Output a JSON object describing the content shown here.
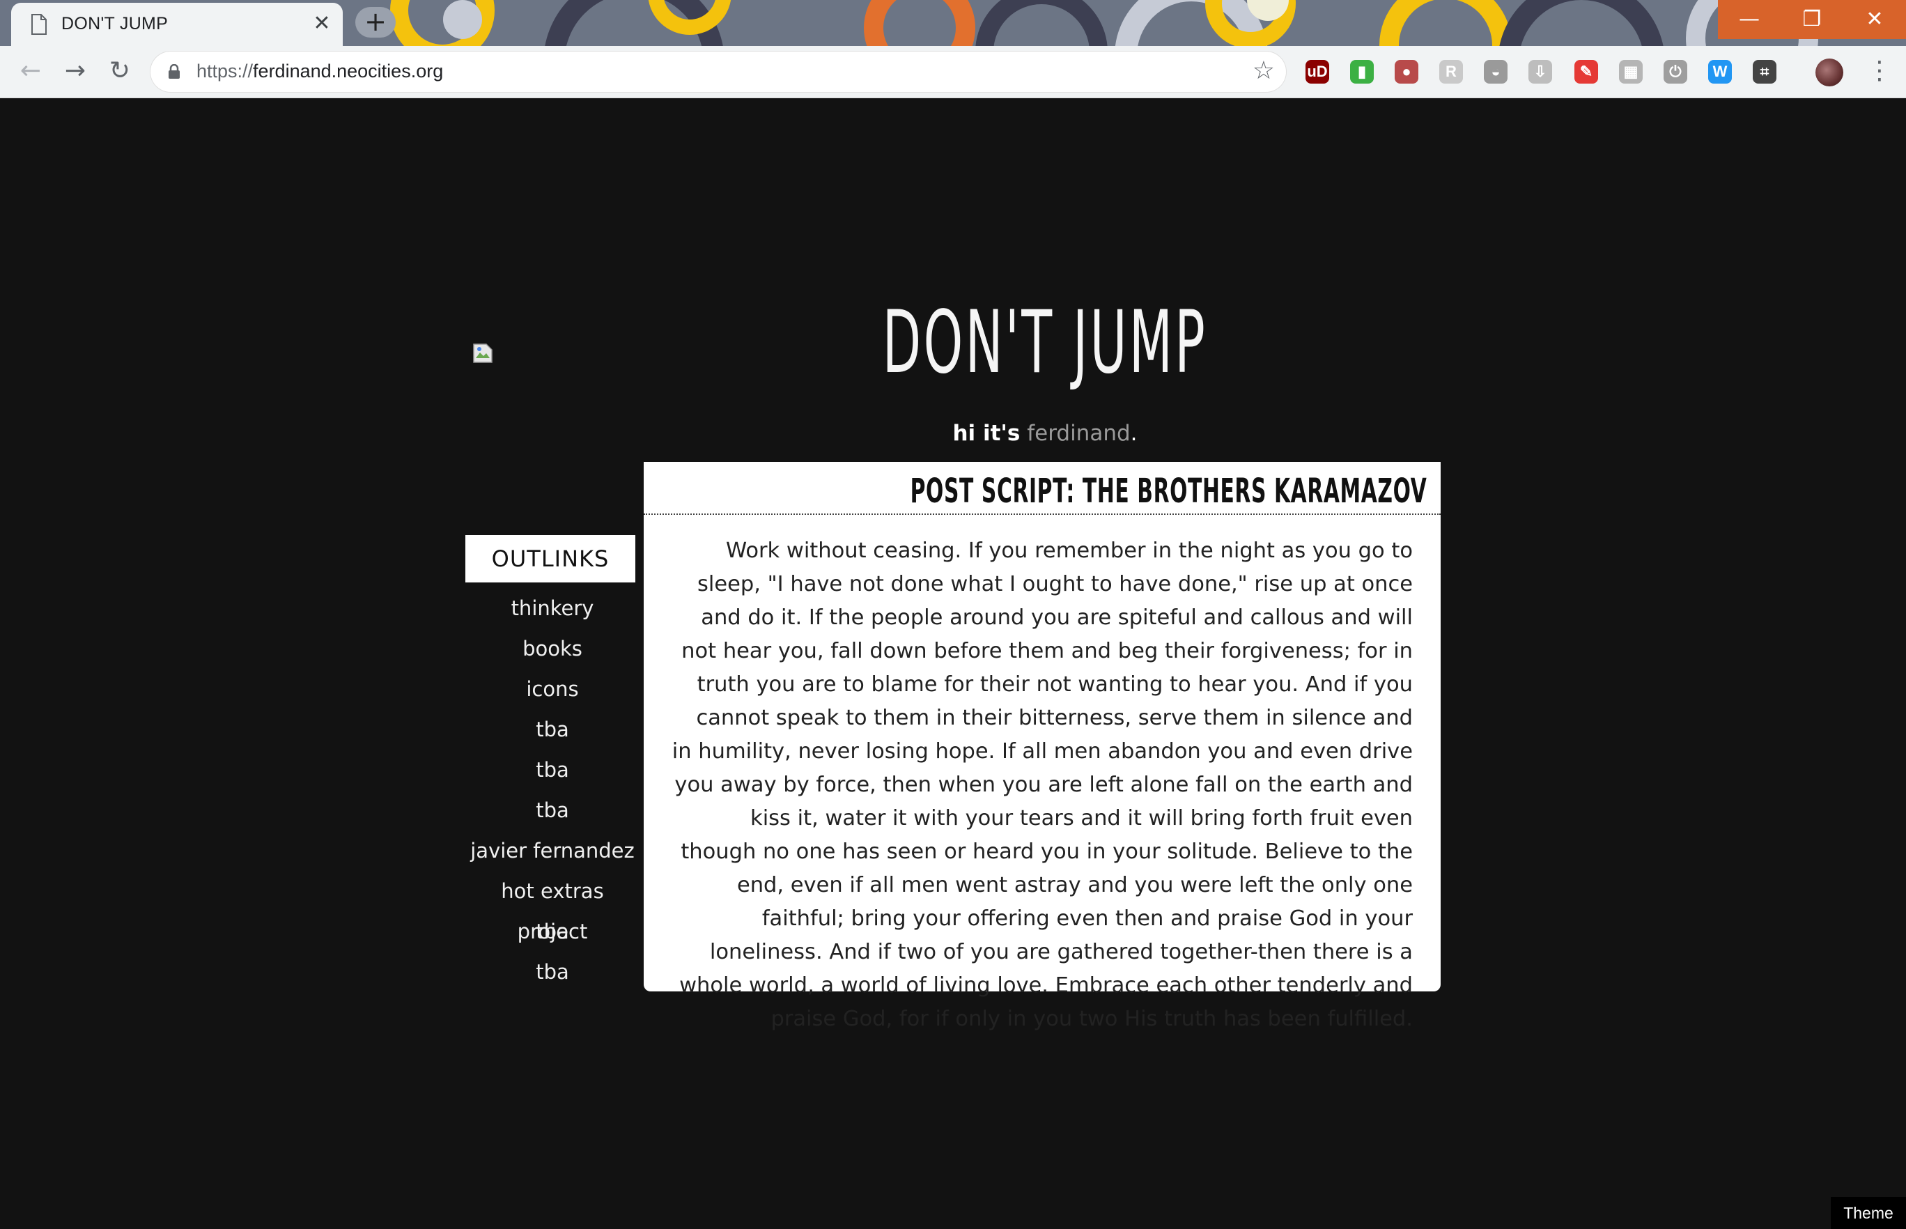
{
  "browser": {
    "tab_title": "DON'T JUMP",
    "tab_close": "✕",
    "new_tab": "+",
    "url_protocol": "https://",
    "url_domain": "ferdinand.neocities.org",
    "star": "☆",
    "window_buttons": [
      "—",
      "❐",
      "✕"
    ],
    "extensions": [
      {
        "name": "ublock-icon",
        "glyph": "uD",
        "color": "#8b0000"
      },
      {
        "name": "battery-extension-icon",
        "glyph": "▮",
        "color": "#3cb043"
      },
      {
        "name": "tomato-extension-icon",
        "glyph": "●",
        "color": "#b84a4a"
      },
      {
        "name": "rx-extension-icon",
        "glyph": "R",
        "color": "#c9c9c9"
      },
      {
        "name": "hat-extension-icon",
        "glyph": "◒",
        "color": "#9a9a9a"
      },
      {
        "name": "download-extension-icon",
        "glyph": "⇩",
        "color": "#bdbdbd"
      },
      {
        "name": "eyedropper-extension-icon",
        "glyph": "✎",
        "color": "#e53935"
      },
      {
        "name": "chart-extension-icon",
        "glyph": "▦",
        "color": "#b5b5b5"
      },
      {
        "name": "power-extension-icon",
        "glyph": "⏻",
        "color": "#9e9e9e"
      },
      {
        "name": "w-extension-icon",
        "glyph": "W",
        "color": "#2196f3"
      },
      {
        "name": "crop-extension-icon",
        "glyph": "⌗",
        "color": "#444444"
      }
    ]
  },
  "page": {
    "title": "DON'T JUMP",
    "subtitle_hi": "hi it's",
    "subtitle_name": "ferdinand",
    "subtitle_end": "."
  },
  "sidebar": {
    "heading": "OUTLINKS",
    "items": [
      {
        "label": "thinkery"
      },
      {
        "label": "books"
      },
      {
        "label": "icons"
      },
      {
        "label": "tba"
      },
      {
        "label": "tba"
      },
      {
        "label": "tba"
      },
      {
        "label": "javier fernandez"
      },
      {
        "label": "hot extras project"
      },
      {
        "label": "tba"
      },
      {
        "label": "tba"
      }
    ]
  },
  "post": {
    "title": "POST SCRIPT: THE BROTHERS KARAMAZOV",
    "body": "Work without ceasing. If you remember in the night as you go to sleep, \"I have not done what I ought to have done,\" rise up at once and do it. If the people around you are spiteful and callous and will not hear you, fall down before them and beg their forgiveness; for in truth you are to blame for their not wanting to hear you. And if you cannot speak to them in their bitterness, serve them in silence and in humility, never losing hope. If all men abandon you and even drive you away by force, then when you are left alone fall on the earth and kiss it, water it with your tears and it will bring forth fruit even though no one has seen or heard you in your solitude. Believe to the end, even if all men went astray and you were left the only one faithful; bring your offering even then and praise God in your loneliness. And if two of you are gathered together-then there is a whole world, a world of living love. Embrace each other tenderly and praise God, for if only in you two His truth has been fulfilled."
  },
  "theme_badge": "Theme"
}
